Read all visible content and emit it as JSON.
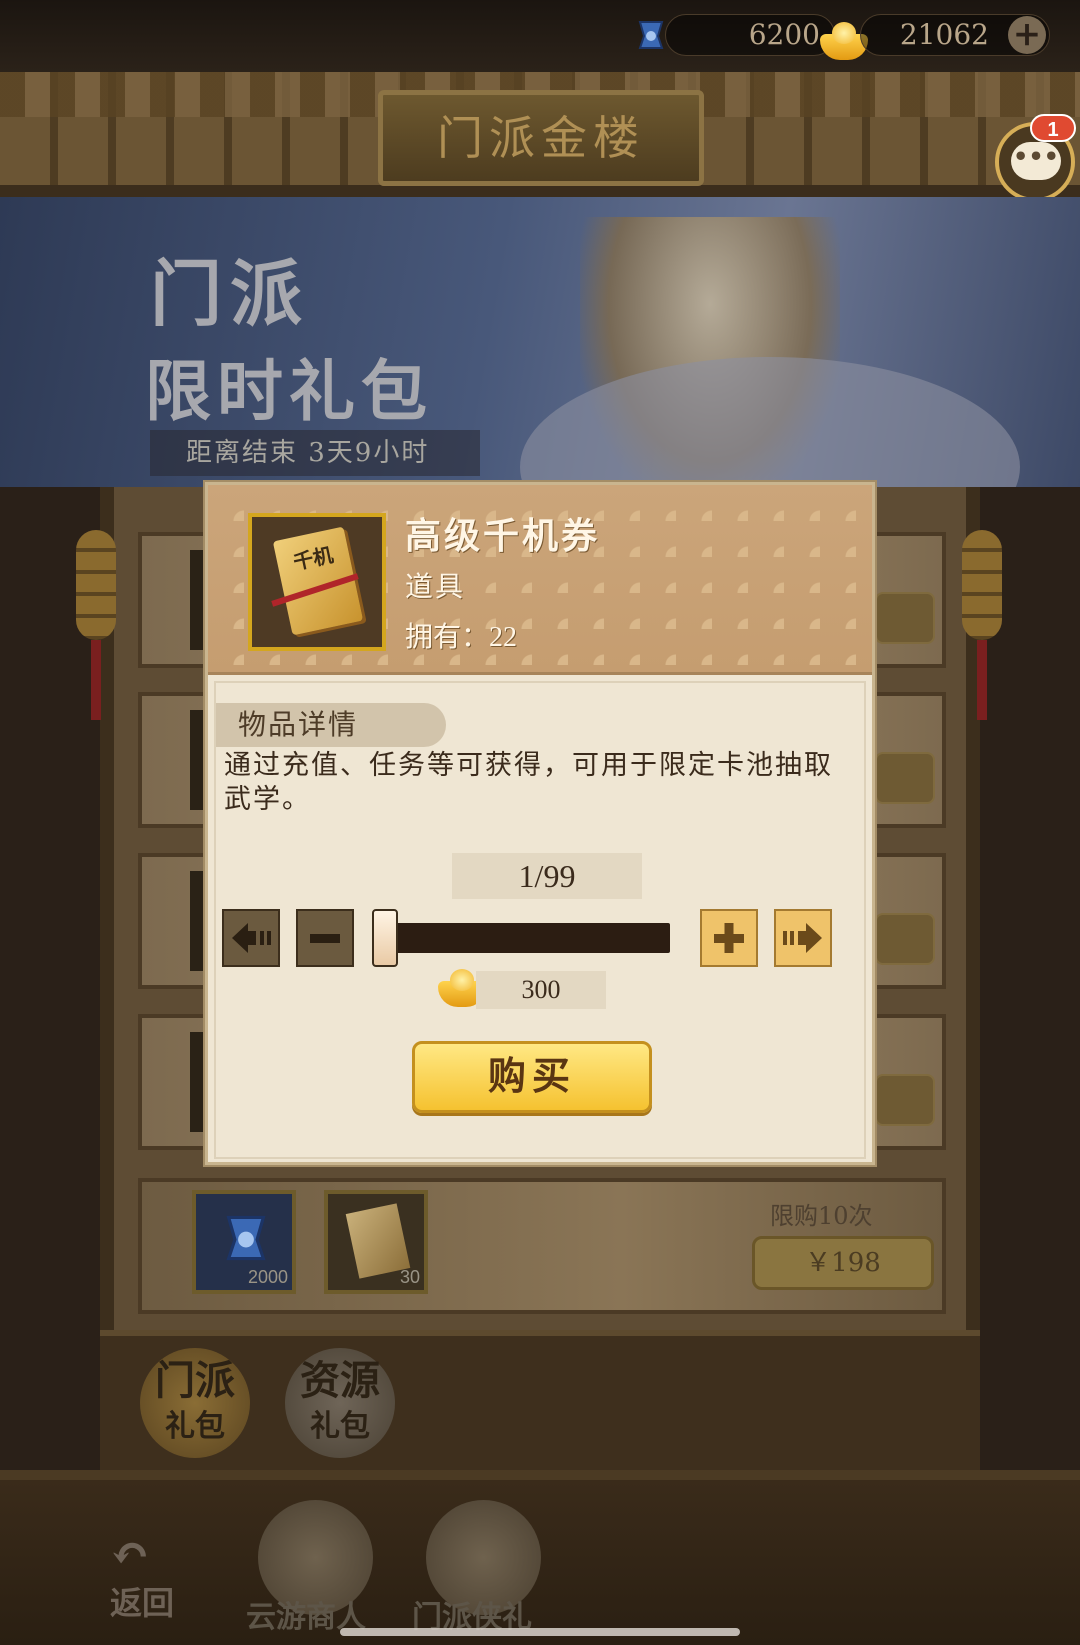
{
  "currency": {
    "jade": {
      "icon": "jade-token-icon",
      "amount": "6200"
    },
    "gold": {
      "icon": "gold-ingot-icon",
      "amount": "21062",
      "add_icon": "plus-icon"
    }
  },
  "header": {
    "title": "门派金楼"
  },
  "chat": {
    "icon": "chat-bubble-icon",
    "badge": "1"
  },
  "banner": {
    "title_line1": "门派",
    "title_line2": "限时礼包",
    "countdown": "距离结束 3天9小时"
  },
  "bundle": {
    "items": [
      {
        "icon": "jade-token-icon",
        "qty": "2000"
      },
      {
        "icon": "qianji-book-icon",
        "qty": "30"
      }
    ],
    "limit": "限购10次",
    "price": "￥198"
  },
  "tabs": [
    {
      "label_line1": "门派",
      "label_line2": "礼包"
    },
    {
      "label_line1": "资源",
      "label_line2": "礼包"
    }
  ],
  "bottom_nav": {
    "back": "返回",
    "items": [
      {
        "label": "云游商人"
      },
      {
        "label": "门派侠礼"
      }
    ]
  },
  "modal": {
    "item_icon": "qianji-book-icon",
    "item_icon_text": "千机",
    "item_name": "高级千机券",
    "item_type": "道具",
    "own_label": "拥有：",
    "own_count": "22",
    "detail_tag": "物品详情",
    "description": "通过充值、任务等可获得，可用于限定卡池抽取武学。",
    "quantity": "1/99",
    "quantity_fraction": 0.01,
    "price": "300",
    "price_icon": "gold-ingot-icon",
    "buy_label": "购买"
  },
  "colors": {
    "accent_gold": "#f5c230",
    "badge_red": "#e04a31",
    "modal_bg": "#efe6d3"
  }
}
